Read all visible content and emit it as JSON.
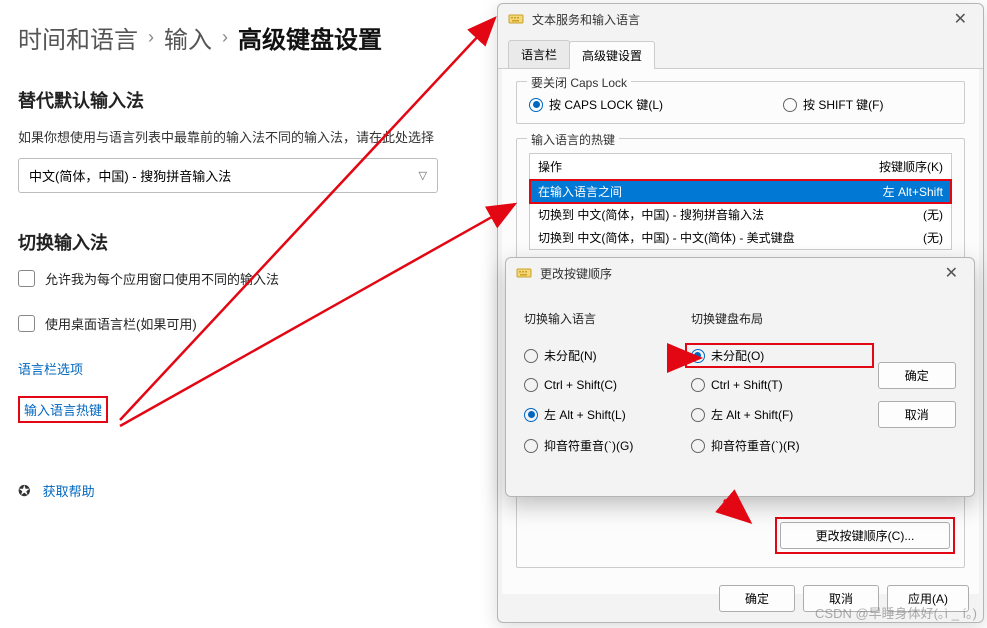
{
  "breadcrumb": {
    "crumb1": "时间和语言",
    "crumb2": "输入",
    "current": "高级键盘设置"
  },
  "sections": {
    "default_ime_title": "替代默认输入法",
    "default_ime_hint": "如果你想使用与语言列表中最靠前的输入法不同的输入法，请在此处选择",
    "default_ime_value": "中文(简体，中国) - 搜狗拼音输入法",
    "switch_ime_title": "切换输入法",
    "chk_per_window": "允许我为每个应用窗口使用不同的输入法",
    "chk_desktop_langbar": "使用桌面语言栏(如果可用)",
    "link_langbar": "语言栏选项",
    "link_hotkey": "输入语言热键",
    "help": "获取帮助"
  },
  "dialog1": {
    "title": "文本服务和输入语言",
    "tab_langbar": "语言栏",
    "tab_advanced": "高级键设置",
    "group_capslock": "要关闭 Caps Lock",
    "radio_capslock": "按 CAPS LOCK 键(L)",
    "radio_shift": "按 SHIFT 键(F)",
    "group_hotkey": "输入语言的热键",
    "col_action": "操作",
    "col_keys": "按键顺序(K)",
    "rows": [
      {
        "action": "在输入语言之间",
        "keys": "左 Alt+Shift",
        "selected": true
      },
      {
        "action": "切换到 中文(简体，中国) - 搜狗拼音输入法",
        "keys": "(无)",
        "selected": false
      },
      {
        "action": "切换到 中文(简体，中国) - 中文(简体) - 美式键盘",
        "keys": "(无)",
        "selected": false
      }
    ],
    "btn_change": "更改按键顺序(C)...",
    "btn_ok": "确定",
    "btn_cancel": "取消",
    "btn_apply": "应用(A)"
  },
  "dialog2": {
    "title": "更改按键顺序",
    "col1_title": "切换输入语言",
    "col2_title": "切换键盘布局",
    "col1": {
      "none": "未分配(N)",
      "ctrlshift": "Ctrl + Shift(C)",
      "altshift": "左 Alt + Shift(L)",
      "grave": "抑音符重音(`)(G)"
    },
    "col2": {
      "none": "未分配(O)",
      "ctrlshift": "Ctrl + Shift(T)",
      "altshift": "左 Alt + Shift(F)",
      "grave": "抑音符重音(`)(R)"
    },
    "btn_ok": "确定",
    "btn_cancel": "取消"
  },
  "watermark": "CSDN @早睡身体好(｡ì _ í｡)"
}
